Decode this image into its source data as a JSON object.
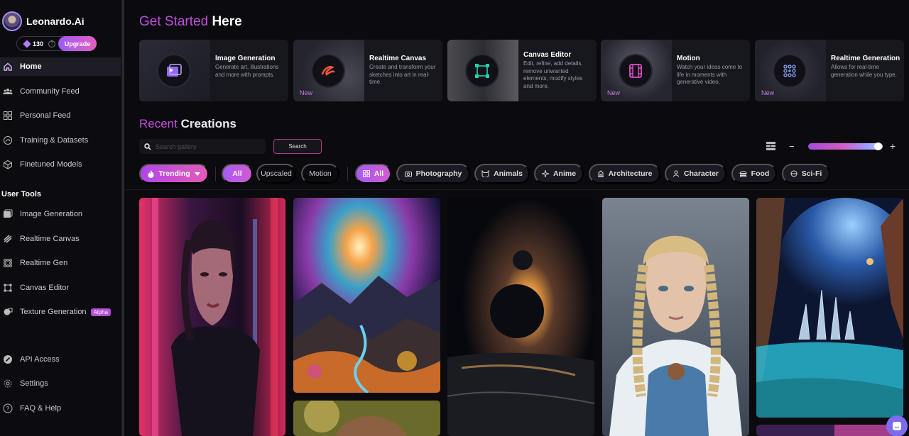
{
  "brand": {
    "name": "Leonardo.",
    "name_suffix": "Ai"
  },
  "credits": {
    "count": "130",
    "help": "?",
    "upgrade_label": "Upgrade"
  },
  "nav": {
    "main": [
      {
        "label": "Home",
        "icon": "home-icon",
        "active": true
      },
      {
        "label": "Community Feed",
        "icon": "community-icon"
      },
      {
        "label": "Personal Feed",
        "icon": "grid-icon"
      },
      {
        "label": "Training & Datasets",
        "icon": "training-icon"
      },
      {
        "label": "Finetuned Models",
        "icon": "cube-icon"
      }
    ],
    "tools_heading": "User Tools",
    "tools": [
      {
        "label": "Image Generation",
        "icon": "image-icon"
      },
      {
        "label": "Realtime Canvas",
        "icon": "brush-icon"
      },
      {
        "label": "Realtime Gen",
        "icon": "dots-grid-icon"
      },
      {
        "label": "Canvas Editor",
        "icon": "frame-icon"
      },
      {
        "label": "Texture Generation",
        "icon": "texture-icon",
        "badge": "Alpha"
      }
    ],
    "bottom": [
      {
        "label": "API Access",
        "icon": "api-icon"
      },
      {
        "label": "Settings",
        "icon": "gear-icon"
      },
      {
        "label": "FAQ & Help",
        "icon": "help-icon"
      }
    ]
  },
  "get_started": {
    "title_accent": "Get Started",
    "title_rest": " Here",
    "cards": [
      {
        "title": "Image Generation",
        "desc": "Generate art, illustrations and more with prompts.",
        "new": "",
        "accent": "#8f6af5"
      },
      {
        "title": "Realtime Canvas",
        "desc": "Create and transform your sketches into art in real-time.",
        "new": "New",
        "accent": "#f0563a"
      },
      {
        "title": "Canvas Editor",
        "desc": "Edit, refine, add details, remove unwanted elements, modify styles and more.",
        "new": "",
        "accent": "#20d4b0"
      },
      {
        "title": "Motion",
        "desc": "Watch your ideas come to life in moments with generative video.",
        "new": "New",
        "accent": "#e04fd0"
      },
      {
        "title": "Realtime Generation",
        "desc": "Allows for real-time generation while you type.",
        "new": "New",
        "accent": "#6f8cf5"
      }
    ]
  },
  "recent": {
    "title_accent": "Recent",
    "title_rest": " Creations",
    "search_placeholder": "Search gallery",
    "search_button": "Search"
  },
  "filters": {
    "sort": "Trending",
    "quality": [
      "All",
      "Upscaled",
      "Motion"
    ],
    "categories": [
      "All",
      "Photography",
      "Animals",
      "Anime",
      "Architecture",
      "Character",
      "Food",
      "Sci-Fi"
    ]
  }
}
